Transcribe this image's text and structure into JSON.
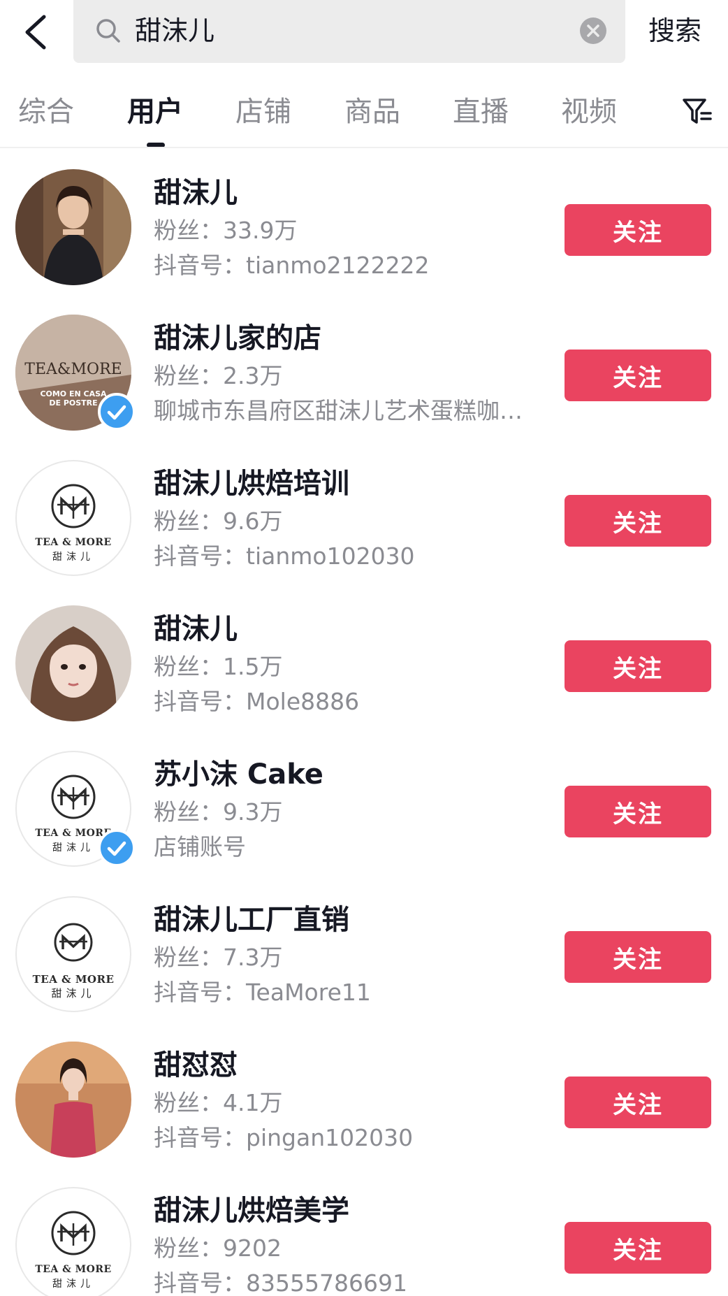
{
  "search": {
    "query": "甜沫儿",
    "submit_label": "搜索"
  },
  "tabs": [
    {
      "label": "综合",
      "active": false
    },
    {
      "label": "用户",
      "active": true
    },
    {
      "label": "店铺",
      "active": false
    },
    {
      "label": "商品",
      "active": false
    },
    {
      "label": "直播",
      "active": false
    },
    {
      "label": "视频",
      "active": false
    }
  ],
  "users": [
    {
      "name": "甜沫儿",
      "fans": "粉丝：33.9万",
      "sub": "抖音号：tianmo2122222",
      "avatar": "photo-woman-dark-dress",
      "verified": false,
      "follow": "关注"
    },
    {
      "name": "甜沫儿家的店",
      "fans": "粉丝：2.3万",
      "sub": "聊城市东昌府区甜沫儿艺术蛋糕咖…",
      "avatar": "shop-logo",
      "verified": true,
      "follow": "关注",
      "logo": {
        "title": "TEA&MORE",
        "line1": "COMO EN CASA",
        "line2": "DE POSTRE"
      }
    },
    {
      "name": "甜沫儿烘焙培训",
      "fans": "粉丝：9.6万",
      "sub": "抖音号：tianmo102030",
      "avatar": "tea-more-logo",
      "verified": false,
      "follow": "关注",
      "logo": {
        "en": "TEA & MORE",
        "cn": "甜沫儿"
      }
    },
    {
      "name": "甜沫儿",
      "fans": "粉丝：1.5万",
      "sub": "抖音号：Mole8886",
      "avatar": "photo-woman-portrait",
      "verified": false,
      "follow": "关注"
    },
    {
      "name": "苏小沫 Cake",
      "fans": "粉丝：9.3万",
      "sub": "店铺账号",
      "avatar": "tea-more-logo",
      "verified": true,
      "follow": "关注",
      "logo": {
        "en": "TEA & MORE",
        "cn": "甜沫儿"
      }
    },
    {
      "name": "甜沫儿工厂直销",
      "fans": "粉丝：7.3万",
      "sub": "抖音号：TeaMore11",
      "avatar": "tea-more-logo",
      "verified": false,
      "follow": "关注",
      "logo": {
        "en": "TEA & MORE",
        "cn": "甜沫儿"
      }
    },
    {
      "name": "甜怼怼",
      "fans": "粉丝：4.1万",
      "sub": "抖音号：pingan102030",
      "avatar": "photo-woman-red-dress",
      "verified": false,
      "follow": "关注"
    },
    {
      "name": "甜沫儿烘焙美学",
      "fans": "粉丝：9202",
      "sub": "抖音号：83555786691",
      "avatar": "tea-more-logo",
      "verified": false,
      "follow": "关注",
      "logo": {
        "en": "TEA & MORE",
        "cn": "甜沫儿"
      }
    }
  ],
  "colors": {
    "follow_button": "#ea4460",
    "verified_badge": "#3d9ef0",
    "secondary_text": "#8a8b91",
    "search_bg": "#ececec"
  }
}
